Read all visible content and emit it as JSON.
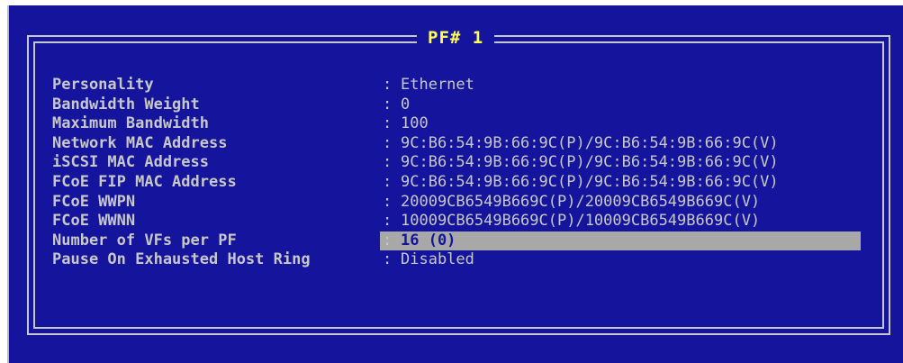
{
  "title": "PF# 1",
  "rows": [
    {
      "label": "Personality",
      "value": "Ethernet",
      "selected": false
    },
    {
      "label": "Bandwidth Weight",
      "value": "0",
      "selected": false
    },
    {
      "label": "Maximum Bandwidth",
      "value": "100",
      "selected": false
    },
    {
      "label": "Network MAC Address",
      "value": "9C:B6:54:9B:66:9C(P)/9C:B6:54:9B:66:9C(V)",
      "selected": false
    },
    {
      "label": "iSCSI MAC Address",
      "value": "9C:B6:54:9B:66:9C(P)/9C:B6:54:9B:66:9C(V)",
      "selected": false
    },
    {
      "label": "FCoE FIP MAC Address",
      "value": "9C:B6:54:9B:66:9C(P)/9C:B6:54:9B:66:9C(V)",
      "selected": false
    },
    {
      "label": "FCoE WWPN",
      "value": "20009CB6549B669C(P)/20009CB6549B669C(V)",
      "selected": false
    },
    {
      "label": "FCoE WWNN",
      "value": "10009CB6549B669C(P)/10009CB6549B669C(V)",
      "selected": false
    },
    {
      "label": "Number of VFs per PF",
      "value": "16 (0)",
      "selected": true
    },
    {
      "label": "Pause On Exhausted Host Ring",
      "value": "Disabled",
      "selected": false
    }
  ],
  "separator": ":",
  "colors": {
    "background": "#14149c",
    "text": "#c8c8c8",
    "title": "#ffff55",
    "highlight": "#a8a8a8"
  }
}
